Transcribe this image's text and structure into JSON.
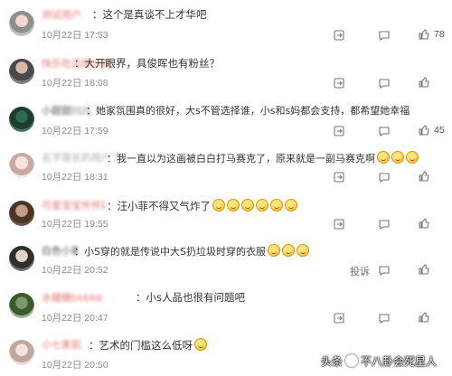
{
  "comments": [
    {
      "name": "测试用户",
      "text": "这个是真谈不上才华吧",
      "date": "10月22日 17:53",
      "likes": "78",
      "emojis": 0
    },
    {
      "name": "快乐吃瓜随心夜",
      "text": "大开眼界，具俊晖也有粉丝？",
      "date": "10月22日 18:08",
      "likes": "",
      "emojis": 0
    },
    {
      "name": "小甜甜川儿",
      "text": "她家氛围真的很好，大s不管选择谁，小s和s妈都会支持，都希望她幸福",
      "date": "10月22日 17:59",
      "likes": "45",
      "emojis": 0
    },
    {
      "name": "名字很长的用户了",
      "text": "我一直以为这画被白白打马赛克了，原来就是一副马赛克啊",
      "date": "10月22日 18:31",
      "likes": "",
      "emojis": 3
    },
    {
      "name": "可爱宝宝怀怀磕瞌线咖很育绵娍",
      "text": "汪小菲不得又气炸了",
      "date": "10月22日 19:55",
      "likes": "",
      "emojis": 6
    },
    {
      "name": "白色小猫咪",
      "text": "小S穿的就是传说中大S扔垃圾时穿的衣服",
      "date": "10月22日 20:52",
      "likes": "",
      "emojis": 3,
      "report": "投诉"
    },
    {
      "name": "水糖糖bbbbb",
      "text": "小s人品也很有问题吧",
      "date": "10月22日 20:47",
      "likes": "",
      "emojis": 0
    },
    {
      "name": "小七素肌",
      "text": "艺术的门槛这么低呀",
      "date": "10月22日 20:50",
      "likes": "",
      "emojis": 1
    }
  ],
  "watermark": {
    "prefix": "头条",
    "author": "不八卦会死星人"
  },
  "icons": {
    "more": "share-icon",
    "comment": "comment-bubble-icon",
    "like": "thumbs-up-icon"
  }
}
